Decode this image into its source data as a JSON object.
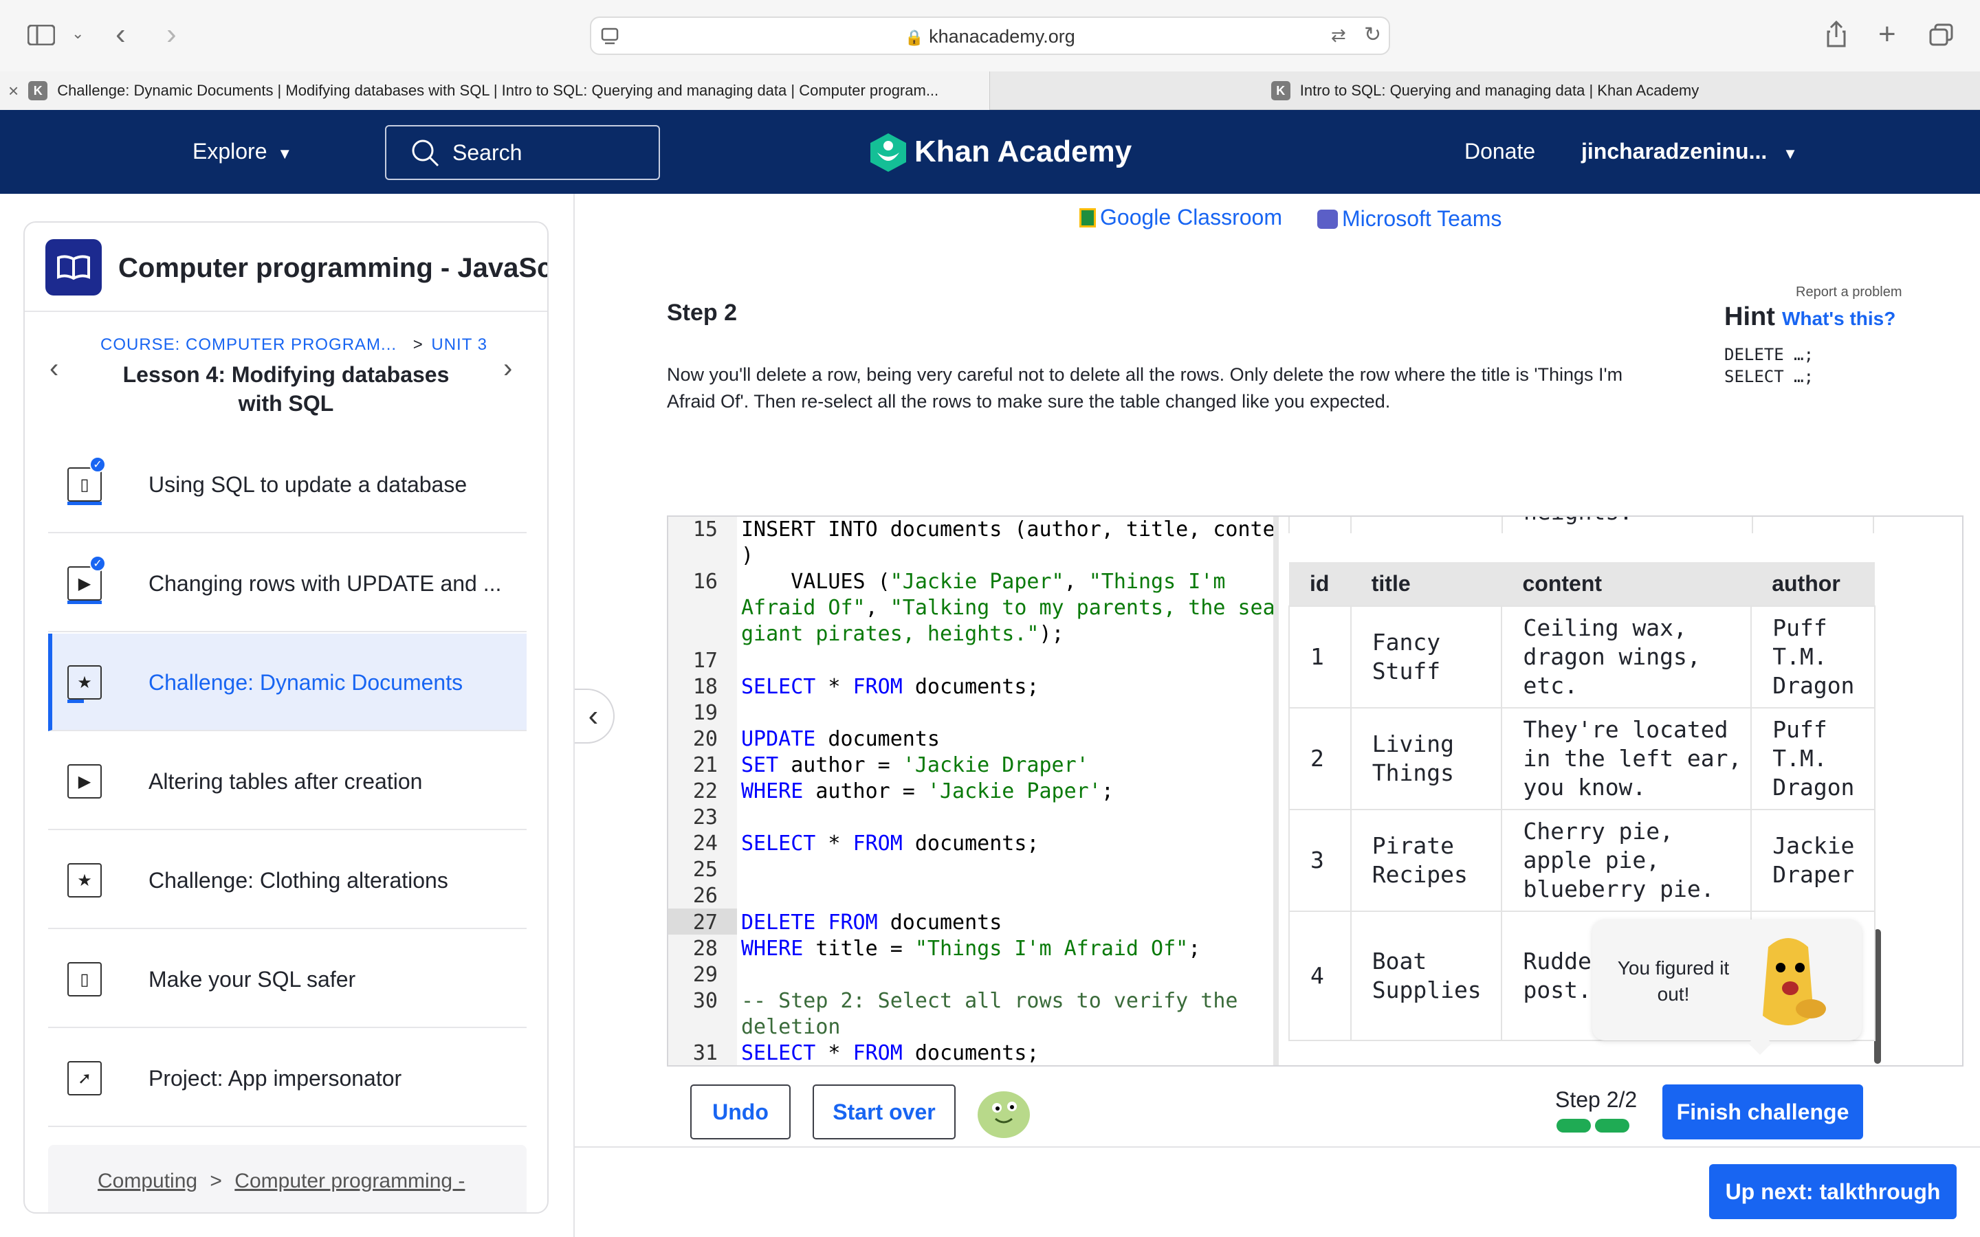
{
  "browser": {
    "url": "khanacademy.org",
    "tabs": [
      {
        "label": "Challenge: Dynamic Documents | Modifying databases with SQL | Intro to SQL: Querying and managing data | Computer program..."
      },
      {
        "label": "Intro to SQL: Querying and managing data | Khan Academy"
      }
    ],
    "favicon_letter": "K"
  },
  "nav": {
    "explore": "Explore",
    "search": "Search",
    "brand": "Khan Academy",
    "donate": "Donate",
    "user": "jincharadzeninu..."
  },
  "sidebar": {
    "course_title": "Computer programming - JavaScr...",
    "crumb_course": "COURSE: COMPUTER PROGRAM...",
    "crumb_unit": "UNIT 3",
    "lesson": "Lesson 4: Modifying databases with SQL",
    "items": [
      {
        "label": "Using SQL to update a database",
        "icon": "article-icon",
        "done": true
      },
      {
        "label": "Changing rows with UPDATE and ...",
        "icon": "video-icon",
        "done": true
      },
      {
        "label": "Challenge: Dynamic Documents",
        "icon": "star-icon",
        "active": true
      },
      {
        "label": "Altering tables after creation",
        "icon": "video-icon"
      },
      {
        "label": "Challenge: Clothing alterations",
        "icon": "star-icon"
      },
      {
        "label": "Make your SQL safer",
        "icon": "article-icon"
      },
      {
        "label": "Project: App impersonator",
        "icon": "rocket-icon"
      }
    ],
    "footer_crumb1": "Computing",
    "footer_crumb2": "Computer programming -"
  },
  "share": {
    "google": "Google Classroom",
    "teams": "Microsoft Teams"
  },
  "challenge": {
    "report": "Report a problem",
    "step_title": "Step 2",
    "instructions": "Now you'll delete a row, being very careful not to delete all the rows. Only delete the row where the title is 'Things I'm Afraid Of'. Then re-select all the rows to make sure the table changed like you expected.",
    "hint_title": "Hint",
    "hint_link": "What's this?",
    "hint_line1": "DELETE …;",
    "hint_line2": "SELECT …;"
  },
  "editor": {
    "lines": [
      {
        "n": "15",
        "text": "INSERT INTO documents (author, title, content"
      },
      {
        "n": "",
        "text": ")"
      },
      {
        "n": "16",
        "text": "    VALUES (\"Jackie Paper\", \"Things I'm"
      },
      {
        "n": "",
        "text": "Afraid Of\", \"Talking to my parents, the sea,"
      },
      {
        "n": "",
        "text": "giant pirates, heights.\");"
      },
      {
        "n": "17",
        "text": ""
      },
      {
        "n": "18",
        "text": "SELECT * FROM documents;"
      },
      {
        "n": "19",
        "text": ""
      },
      {
        "n": "20",
        "text": "UPDATE documents"
      },
      {
        "n": "21",
        "text": "SET author = 'Jackie Draper'"
      },
      {
        "n": "22",
        "text": "WHERE author = 'Jackie Paper';"
      },
      {
        "n": "23",
        "text": ""
      },
      {
        "n": "24",
        "text": "SELECT * FROM documents;"
      },
      {
        "n": "25",
        "text": ""
      },
      {
        "n": "26",
        "text": ""
      },
      {
        "n": "27",
        "text": "DELETE FROM documents"
      },
      {
        "n": "28",
        "text": "WHERE title = \"Things I'm Afraid Of\";"
      },
      {
        "n": "29",
        "text": ""
      },
      {
        "n": "30",
        "text": "-- Step 2: Select all rows to verify the"
      },
      {
        "n": "",
        "text": "deletion"
      },
      {
        "n": "31",
        "text": "SELECT * FROM documents;"
      }
    ]
  },
  "results": {
    "partial_top": "heights.",
    "columns": [
      "id",
      "title",
      "content",
      "author"
    ],
    "rows": [
      {
        "id": "1",
        "title": "Fancy Stuff",
        "content": "Ceiling wax, dragon wings, etc.",
        "author": "Puff T.M. Dragon"
      },
      {
        "id": "2",
        "title": "Living Things",
        "content": "They're located in the left ear, you know.",
        "author": "Puff T.M. Dragon"
      },
      {
        "id": "3",
        "title": "Pirate Recipes",
        "content": "Cherry pie, apple pie, blueberry pie.",
        "author": "Jackie Draper"
      },
      {
        "id": "4",
        "title": "Boat Supplies",
        "content": "Rudde guita mast post.",
        "author": ""
      }
    ]
  },
  "toast": "You figured it out!",
  "bottom": {
    "undo": "Undo",
    "start_over": "Start over",
    "step": "Step 2/2",
    "step_progress": 1.0,
    "finish": "Finish challenge",
    "up_next": "Up next: talkthrough"
  },
  "colors": {
    "nav_bg": "#0a2a66",
    "accent": "#1865f2",
    "active_bg": "#e8eefc"
  }
}
